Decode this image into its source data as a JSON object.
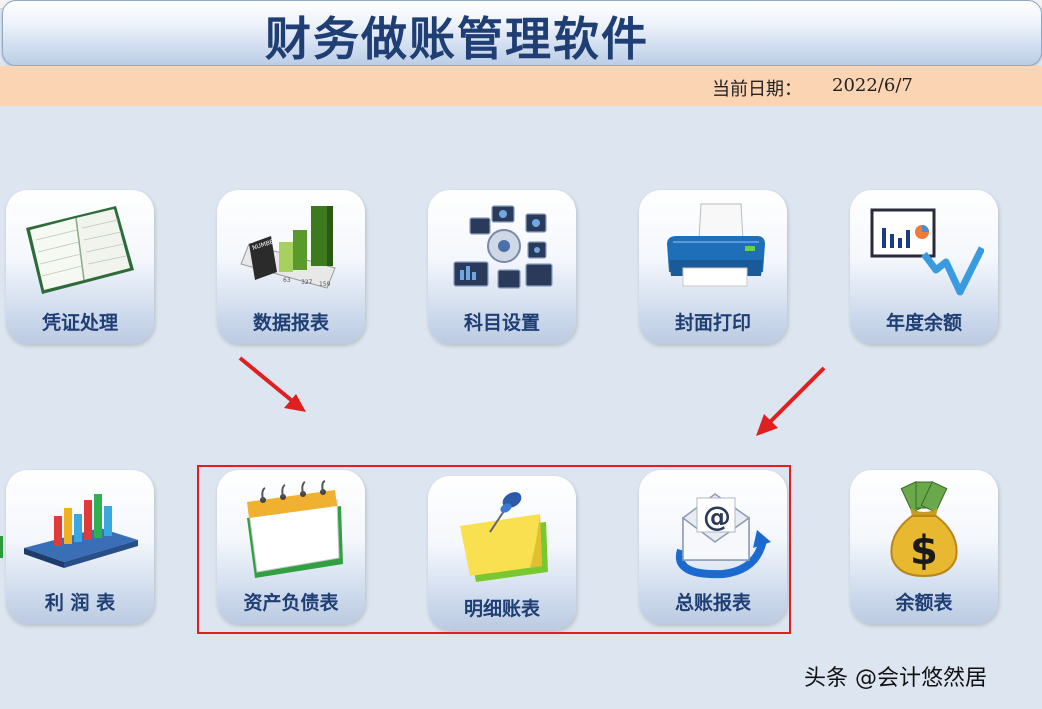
{
  "header": {
    "title": "财务做账管理软件",
    "date_label": "当前日期：",
    "date_value": "2022/6/7"
  },
  "tiles_row1": [
    {
      "label": "凭证处理",
      "icon": "ledger-book-icon"
    },
    {
      "label": "数据报表",
      "icon": "numbers-chart-icon"
    },
    {
      "label": "科目设置",
      "icon": "settings-gear-icon"
    },
    {
      "label": "封面打印",
      "icon": "printer-icon"
    },
    {
      "label": "年度余额",
      "icon": "trend-chart-icon"
    }
  ],
  "tiles_row2": [
    {
      "label": "利 润 表",
      "icon": "bar-chart-icon"
    },
    {
      "label": "资产负债表",
      "icon": "calendar-icon"
    },
    {
      "label": "明细账表",
      "icon": "sticky-note-pin-icon"
    },
    {
      "label": "总账报表",
      "icon": "email-at-icon"
    },
    {
      "label": "余额表",
      "icon": "money-bag-icon"
    }
  ],
  "watermark": "头条 @会计悠然居",
  "colors": {
    "title_text": "#1f3e73",
    "date_bar": "#fbd4b4",
    "background": "#dde6f0",
    "highlight": "#e02020"
  }
}
